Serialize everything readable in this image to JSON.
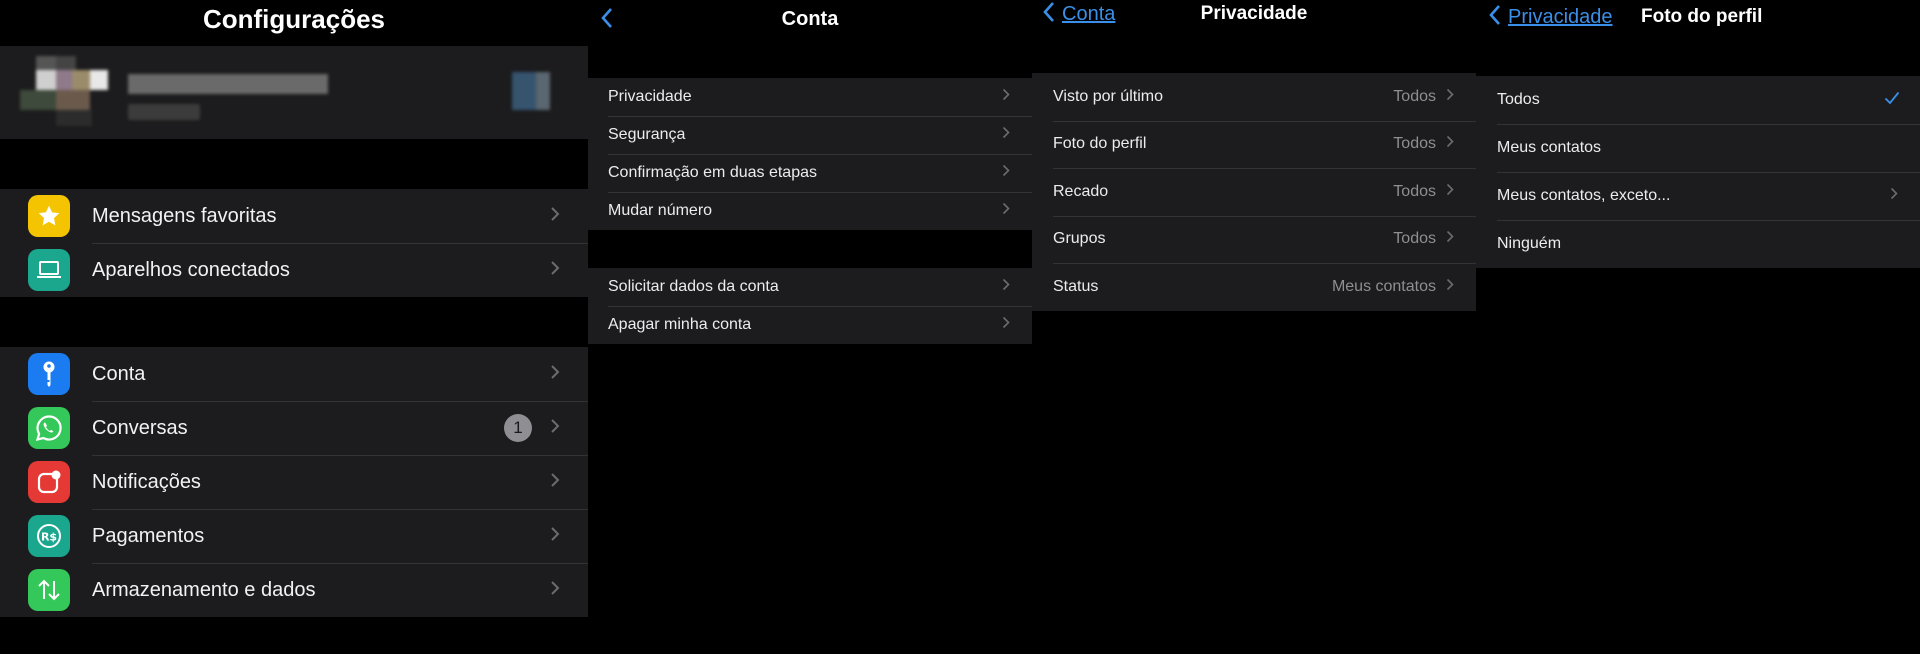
{
  "settings": {
    "title": "Configurações",
    "group1": [
      {
        "label": "Mensagens favoritas",
        "icon": "star-icon",
        "color": "#f5c400"
      },
      {
        "label": "Aparelhos conectados",
        "icon": "laptop-icon",
        "color": "#1ba68e"
      }
    ],
    "group2": [
      {
        "label": "Conta",
        "icon": "key-icon",
        "color": "#1a7cf0"
      },
      {
        "label": "Conversas",
        "icon": "whatsapp-icon",
        "color": "#34c759",
        "badge": "1"
      },
      {
        "label": "Notificações",
        "icon": "notification-icon",
        "color": "#e53935"
      },
      {
        "label": "Pagamentos",
        "icon": "currency-icon",
        "color": "#1ba68e"
      },
      {
        "label": "Armazenamento e dados",
        "icon": "data-transfer-icon",
        "color": "#34c759"
      }
    ]
  },
  "account": {
    "title": "Conta",
    "group1": [
      "Privacidade",
      "Segurança",
      "Confirmação em duas etapas",
      "Mudar número"
    ],
    "group2": [
      "Solicitar dados da conta",
      "Apagar minha conta"
    ]
  },
  "privacy": {
    "back_label": "Conta",
    "title": "Privacidade",
    "rows": [
      {
        "label": "Visto por último",
        "value": "Todos"
      },
      {
        "label": "Foto do perfil",
        "value": "Todos"
      },
      {
        "label": "Recado",
        "value": "Todos"
      },
      {
        "label": "Grupos",
        "value": "Todos"
      },
      {
        "label": "Status",
        "value": "Meus contatos"
      }
    ]
  },
  "profile_photo": {
    "back_label": "Privacidade",
    "title": "Foto do perfil",
    "options": [
      "Todos",
      "Meus contatos",
      "Meus contatos, exceto...",
      "Ninguém"
    ],
    "selected_index": 0
  },
  "colors": {
    "accent": "#3a8fe8",
    "cell_bg": "#1c1c1e",
    "secondary_text": "#8e8e93"
  }
}
